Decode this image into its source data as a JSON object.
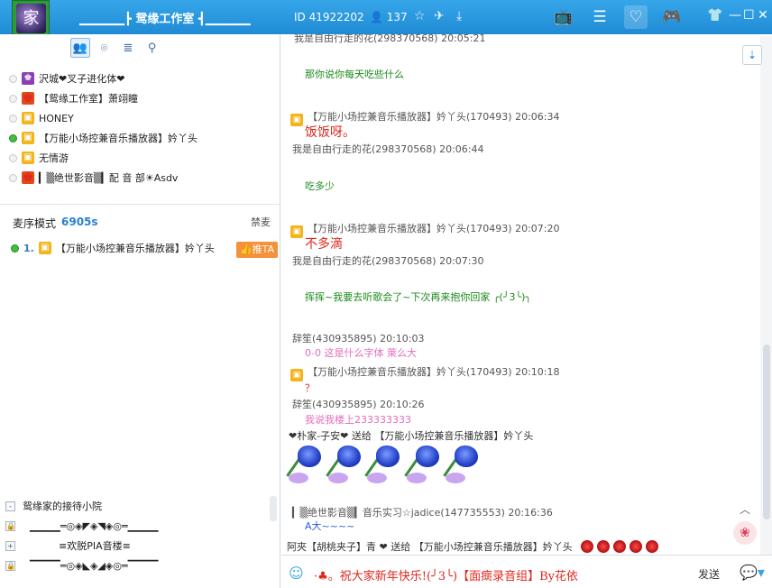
{
  "header": {
    "logo_text": "家",
    "logo_badge": "0",
    "room_title": "▁▁▁▁▁┣ 鸳缘工作室 ┫▁▁▁▁▁",
    "room_id": "ID 41922202",
    "user_count": "137",
    "icons": [
      "star-icon",
      "plane-icon",
      "download-icon"
    ],
    "nav": [
      "tv-icon",
      "list-icon",
      "heart-icon",
      "gamepad-icon"
    ],
    "window_controls": [
      "skin-icon",
      "minimize-icon",
      "maximize-icon",
      "close-icon"
    ]
  },
  "left": {
    "toolbar": [
      "users-icon",
      "location-icon",
      "list-icon",
      "search-icon"
    ],
    "users": [
      {
        "name": "沢城❤叉子进化体❤",
        "badge": "purple",
        "online": false
      },
      {
        "name": "【鸳缘工作室】萧翊瞳",
        "badge": "red",
        "online": false
      },
      {
        "name": "HONEY",
        "badge": "gift",
        "online": false
      },
      {
        "name": "【万能小场控兼音乐播放器】妗丫头",
        "badge": "gift",
        "online": true
      },
      {
        "name": "无情游",
        "badge": "gift",
        "online": false
      },
      {
        "name": "▎▒绝世影音▒▎配 音 部☀Asdv",
        "badge": "red",
        "online": false
      }
    ],
    "queue": {
      "label": "麦序模式",
      "time": "6905s",
      "forbid_label": "禁麦",
      "entry_num": "1.",
      "entry_name": "【万能小场控兼音乐播放器】妗丫头",
      "push_label": "推TA"
    },
    "rooms": [
      {
        "ctl": "-",
        "name": "鸳缘家的接待小院"
      },
      {
        "ctl": "🔒",
        "name": "▁▁▁▁═◎◈◤◈◥◈◎═▁▁▁▁"
      },
      {
        "ctl": "+",
        "name": "≡欢脱PIA音楼≡"
      },
      {
        "ctl": "🔒",
        "name": "▔▔▔▔═◎◈◣◈◢◈◎═▔▔▔▔"
      }
    ]
  },
  "chat": {
    "top_partial": "我是自由行走的花(298370568) 20:05:21",
    "m1_text": "那你说你每天吃些什么",
    "m2_meta": "【万能小场控兼音乐播放器】妗丫头(170493) 20:06:34",
    "m2_text": "饭饭呀。",
    "m3_meta": "我是自由行走的花(298370568) 20:06:44",
    "m3_text": "吃多少",
    "m4_meta": "【万能小场控兼音乐播放器】妗丫头(170493) 20:07:20",
    "m4_text": "不多滴",
    "m5_meta": "我是自由行走的花(298370568) 20:07:30",
    "m5_text": "挥挥~我要去听歌会了~下次再来抱你回家 ╭(╯3╰)╮",
    "m6_meta": "辞笙(430935895) 20:10:03",
    "m6_text": "0-0 这是什么字体 萊么大",
    "m7_meta": "【万能小场控兼音乐播放器】妗丫头(170493) 20:10:18",
    "m7_text": "？",
    "m8_meta": "辞笙(430935895) 20:10:26",
    "m8_text": "我说我楼上233333333",
    "gift1": "❤朴家-子安❤ 送给 【万能小场控兼音乐播放器】妗丫头",
    "m9_meta": "▎▒绝世影音▒▎音乐实习☆jadice(147735553) 20:16:36",
    "m9_text": "A大~~~~",
    "gift2": "阿夾【胡桃夹子】青 ❤ 送给 【万能小场控兼音乐播放器】妗丫头"
  },
  "input": {
    "text": "·♣。祝大家新年快乐!(╯3╰)【面癍录音组】By花依",
    "send_label": "发送"
  },
  "colors": {
    "topbar": "#1f8bd5",
    "green_text": "#1b8a1b",
    "red_text": "#e0261b",
    "pink_text": "#e36cbd",
    "accent": "#2a7fd6"
  }
}
